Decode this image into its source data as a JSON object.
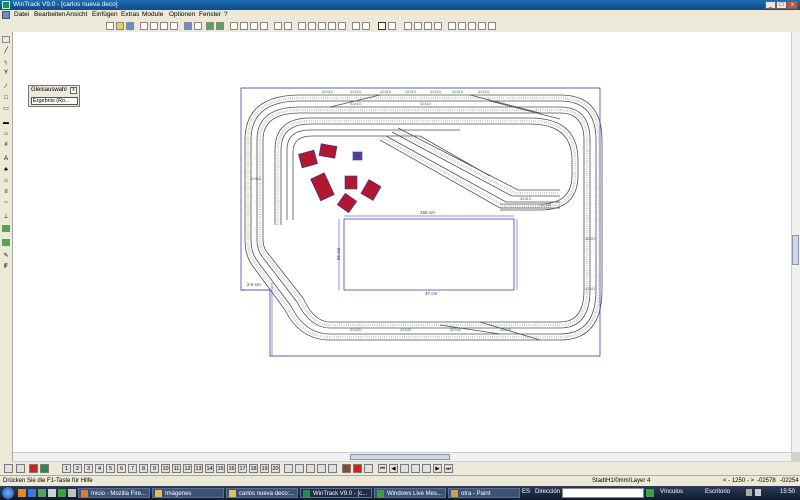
{
  "window": {
    "title": "WinTrack  V9.0 - [carlos nueva deco]",
    "minimize": "_",
    "maximize": "□",
    "close": "x"
  },
  "menu": [
    "Datei",
    "Bearbeiten",
    "Ansicht",
    "Einfügen",
    "Extras",
    "Module",
    "Optionen",
    "Fenster",
    "?"
  ],
  "palette": {
    "title": "Gleisauswahl",
    "close": "x",
    "selected": "Ergebnis (Ro..."
  },
  "track_labels": [
    "42410",
    "42410",
    "42410",
    "42410",
    "42410",
    "42410",
    "42410",
    "42410",
    "42410",
    "42410",
    "42410",
    "42410",
    "42410",
    "42410",
    "42440",
    "42441",
    "42440",
    "42440"
  ],
  "dimensions": {
    "top": "155 cm",
    "left": "56 cm",
    "side": "2-5 cm",
    "bottom": "47 cm"
  },
  "layer_numbers": [
    "1",
    "2",
    "3",
    "4",
    "5",
    "6",
    "7",
    "8",
    "9",
    "10",
    "11",
    "12",
    "13",
    "14",
    "15",
    "16",
    "17",
    "18",
    "19",
    "20"
  ],
  "status": {
    "help": "Drücken Sie die  F1-Taste für Hilfe",
    "layer": "StadtH1/0mm/Layer 4",
    "zoom": "< - 1250 - >",
    "x": "-02578",
    "y": "-02254"
  },
  "taskbar": {
    "tasks": [
      "Inicio - Mozilla Fire...",
      "Imágenes",
      "carlos nueva deco:...",
      "WinTrack  V9.0 - [c...",
      "Windows Live Mes...",
      "otra - Paint"
    ],
    "lang": "ES",
    "address_label": "Dirección",
    "links": "Vínculos",
    "desktop": "Escritorio",
    "clock": "15:50"
  },
  "colors": {
    "track": "#505050",
    "sleeper": "#b0b0b0",
    "label": "#1a8a3a",
    "board": "#2a2aa0",
    "building": "#b01830"
  }
}
